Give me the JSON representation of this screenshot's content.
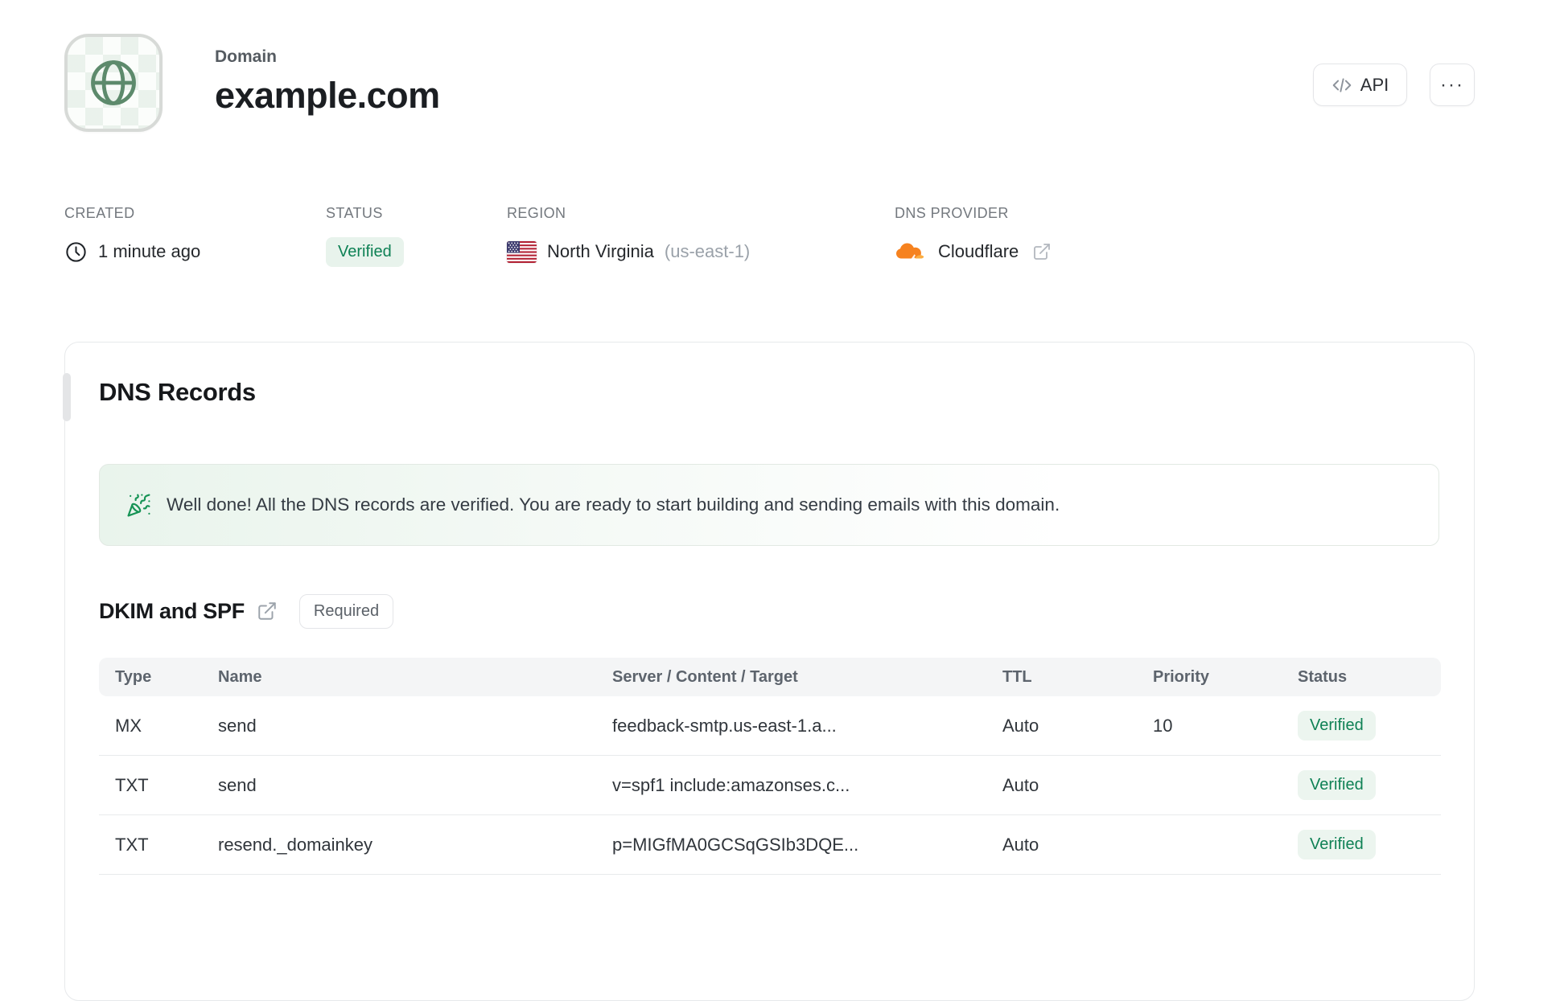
{
  "header": {
    "eyebrow": "Domain",
    "title": "example.com",
    "api_button_label": "API",
    "more_button_label": "···"
  },
  "meta": {
    "created": {
      "label": "CREATED",
      "value": "1 minute ago"
    },
    "status": {
      "label": "STATUS",
      "value": "Verified"
    },
    "region": {
      "label": "REGION",
      "value": "North Virginia",
      "code": "(us-east-1)"
    },
    "dns_provider": {
      "label": "DNS PROVIDER",
      "value": "Cloudflare"
    }
  },
  "dns_card": {
    "title": "DNS Records",
    "banner_message": "Well done! All the DNS records are verified. You are ready to start building and sending emails with this domain.",
    "section": {
      "title": "DKIM and SPF",
      "badge": "Required"
    },
    "table": {
      "headers": [
        "Type",
        "Name",
        "Server / Content / Target",
        "TTL",
        "Priority",
        "Status"
      ],
      "rows": [
        {
          "type": "MX",
          "name": "send",
          "content": "feedback-smtp.us-east-1.a...",
          "ttl": "Auto",
          "priority": "10",
          "status": "Verified"
        },
        {
          "type": "TXT",
          "name": "send",
          "content": "v=spf1 include:amazonses.c...",
          "ttl": "Auto",
          "priority": "",
          "status": "Verified"
        },
        {
          "type": "TXT",
          "name": "resend._domainkey",
          "content": "p=MIGfMA0GCSqGSIb3DQE...",
          "ttl": "Auto",
          "priority": "",
          "status": "Verified"
        }
      ]
    }
  },
  "icons": {
    "globe-icon": "green globe outline",
    "clock-icon": "clock outline",
    "us-flag-icon": "united states flag",
    "cloudflare-icon": "orange cloudflare cloud",
    "external-link-icon": "box with arrow up-right",
    "confetti-icon": "green party popper",
    "code-icon": "</>",
    "more-icon": "horizontal ellipsis"
  },
  "colors": {
    "accent_green": "#0f8155",
    "verified_bg": "#ecf5ef",
    "banner_green": "#e9f4ec",
    "cloudflare_orange": "#f6821f",
    "cloudflare_light_orange": "#fbad41",
    "globe_green": "#5d8a6c",
    "flag_red": "#b22234",
    "flag_blue": "#3c3b6e"
  }
}
